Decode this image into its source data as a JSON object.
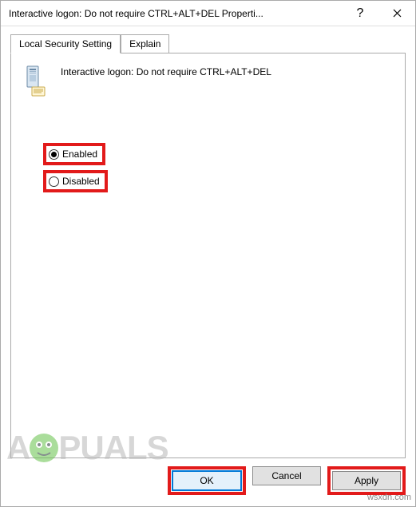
{
  "window": {
    "title": "Interactive logon: Do not require CTRL+ALT+DEL Properti..."
  },
  "tabs": {
    "local_security": "Local Security Setting",
    "explain": "Explain"
  },
  "policy": {
    "title": "Interactive logon: Do not require CTRL+ALT+DEL"
  },
  "options": {
    "enabled": "Enabled",
    "disabled": "Disabled",
    "selected": "enabled"
  },
  "buttons": {
    "ok": "OK",
    "cancel": "Cancel",
    "apply": "Apply"
  },
  "watermark": {
    "brand_a": "A",
    "brand_rest": "PUALS"
  },
  "source": "wsxdn.com"
}
